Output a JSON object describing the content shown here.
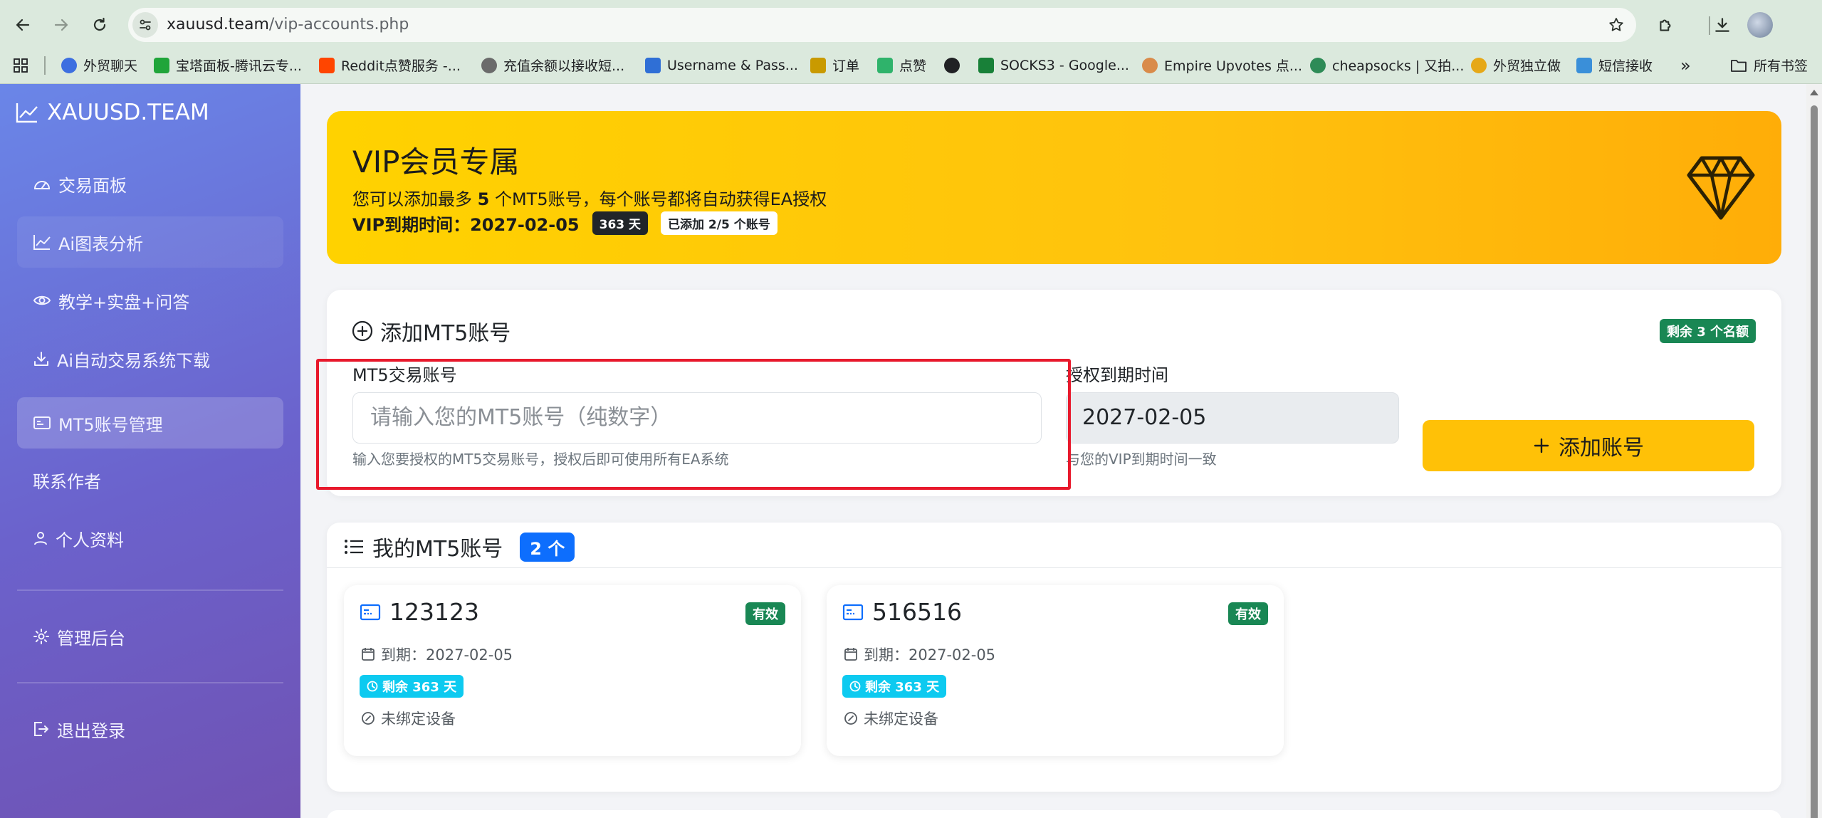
{
  "browser": {
    "url_host": "xauusd.team",
    "url_path": "/vip-accounts.php",
    "bookmarks": [
      {
        "label": "外贸聊天",
        "color": "#3d6fe0"
      },
      {
        "label": "宝塔面板-腾讯云专...",
        "color": "#20a53a"
      },
      {
        "label": "Reddit点赞服务 -...",
        "color": "#ff4500"
      },
      {
        "label": "充值余额以接收短...",
        "color": "#6b6b6b"
      },
      {
        "label": "Username & Pass...",
        "color": "#2f6fd6"
      },
      {
        "label": "订单",
        "color": "#c99a00"
      },
      {
        "label": "点赞",
        "color": "#2fb36b"
      },
      {
        "label": "SOCKS3 - Google...",
        "color": "#188038"
      },
      {
        "label": "Empire Upvotes 点...",
        "color": "#d98b4a"
      },
      {
        "label": "cheapsocks | 又拍...",
        "color": "#2e8b57"
      },
      {
        "label": "外贸独立做",
        "color": "#e6a817"
      },
      {
        "label": "短信接收",
        "color": "#3a8fd9"
      }
    ],
    "more": "»",
    "all_bookmarks": "所有书签"
  },
  "sidebar": {
    "brand": "XAUUSD.TEAM",
    "items": [
      {
        "label": "交易面板"
      },
      {
        "label": "Ai图表分析"
      },
      {
        "label": "教学+实盘+问答"
      },
      {
        "label": "Ai自动交易系统下载"
      },
      {
        "label": "MT5账号管理"
      },
      {
        "label": "联系作者"
      },
      {
        "label": "个人资料"
      },
      {
        "label": "管理后台"
      },
      {
        "label": "退出登录"
      }
    ]
  },
  "vip": {
    "title": "VIP会员专属",
    "desc_prefix": "您可以添加最多 ",
    "desc_count": "5",
    "desc_suffix": " 个MT5账号，每个账号都将自动获得EA授权",
    "expiry_label": "VIP到期时间：2027-02-05",
    "days_badge": "363 天",
    "added_badge": "已添加 2/5 个账号"
  },
  "add_form": {
    "title": "添加MT5账号",
    "remaining_badge": "剩余 3 个名额",
    "account_label": "MT5交易账号",
    "account_placeholder": "请输入您的MT5账号（纯数字）",
    "account_help": "输入您要授权的MT5交易账号，授权后即可使用所有EA系统",
    "expiry_label": "授权到期时间",
    "expiry_value": "2027-02-05",
    "expiry_help": "与您的VIP到期时间一致",
    "add_button": "添加账号"
  },
  "accounts": {
    "title": "我的MT5账号",
    "count_badge": "2 个",
    "items": [
      {
        "number": "123123",
        "status": "有效",
        "expiry": "到期：2027-02-05",
        "remaining": "剩余 363 天",
        "device": "未绑定设备"
      },
      {
        "number": "516516",
        "status": "有效",
        "expiry": "到期：2027-02-05",
        "remaining": "剩余 363 天",
        "device": "未绑定设备"
      }
    ]
  },
  "colors": {
    "sidebar_gradient_start": "#6a86e8",
    "sidebar_gradient_end": "#7052b3",
    "vip_yellow": "#ffc20e",
    "add_button": "#ffc107",
    "success_green": "#198754",
    "primary_blue": "#0d6efd",
    "info_cyan": "#0dcaf0",
    "highlight_red": "#e8192c"
  }
}
